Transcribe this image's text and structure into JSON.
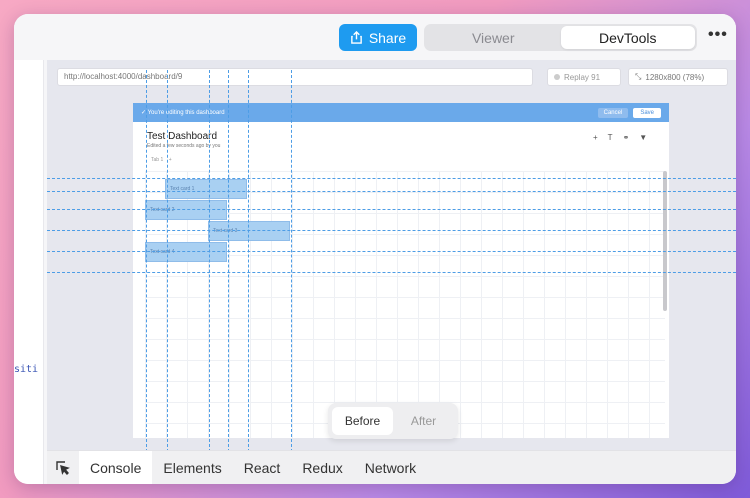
{
  "topbar": {
    "share_label": "Share",
    "view_modes": [
      {
        "label": "Viewer",
        "active": false
      },
      {
        "label": "DevTools",
        "active": true
      }
    ],
    "more_icon": "more-horizontal-icon"
  },
  "left_panel": {
    "truncated_text": "siti"
  },
  "viewer": {
    "url": "http://localhost:4000/dashboard/9",
    "replay_label": "Replay 91",
    "resolution_label": "1280x800 (78%)"
  },
  "app": {
    "banner_text": "✓ You're editing this dashboard",
    "cancel_label": "Cancel",
    "save_label": "Save",
    "title": "Test Dashboard",
    "subtitle": "Edited a few seconds ago by you",
    "tab_label": "Tab 1",
    "add_tab": "+",
    "cards": [
      {
        "label": "Text card 1"
      },
      {
        "label": "Text card 2"
      },
      {
        "label": "Text card 3"
      },
      {
        "label": "Text card 4"
      }
    ]
  },
  "compare": {
    "before_label": "Before",
    "after_label": "After"
  },
  "bottom_tabs": [
    {
      "label": "Console",
      "active": true
    },
    {
      "label": "Elements",
      "active": false
    },
    {
      "label": "React",
      "active": false
    },
    {
      "label": "Redux",
      "active": false
    },
    {
      "label": "Network",
      "active": false
    }
  ],
  "colors": {
    "accent": "#1e9bf0",
    "banner": "#6aa9ea",
    "card": "#a9d0f2",
    "guide": "#4d9de6"
  }
}
